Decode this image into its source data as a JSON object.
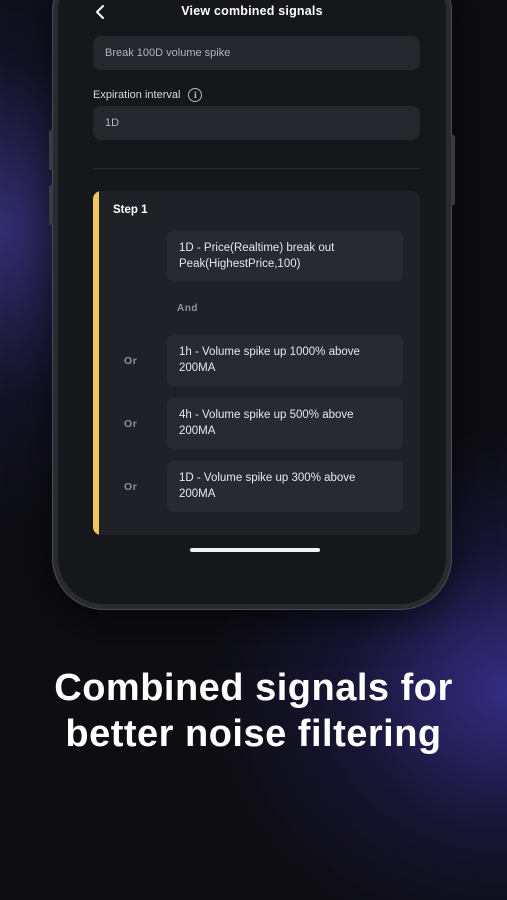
{
  "header": {
    "title": "View combined signals",
    "back_icon": "chevron-left-icon"
  },
  "form": {
    "signal_name_value": "Break 100D volume spike",
    "expiration_label": "Expiration interval",
    "expiration_info_icon": "info-icon",
    "expiration_value": "1D"
  },
  "step": {
    "title": "Step 1",
    "accent_color": "#f0c75a",
    "first_condition": "1D - Price(Realtime) break out Peak(HighestPrice,100)",
    "and_label": "And",
    "or_conditions": [
      {
        "connector": "Or",
        "text": "1h - Volume spike up 1000% above 200MA"
      },
      {
        "connector": "Or",
        "text": "4h - Volume spike up 500% above 200MA"
      },
      {
        "connector": "Or",
        "text": "1D - Volume spike up 300% above 200MA"
      }
    ]
  },
  "headline": "Combined signals for better noise filtering"
}
